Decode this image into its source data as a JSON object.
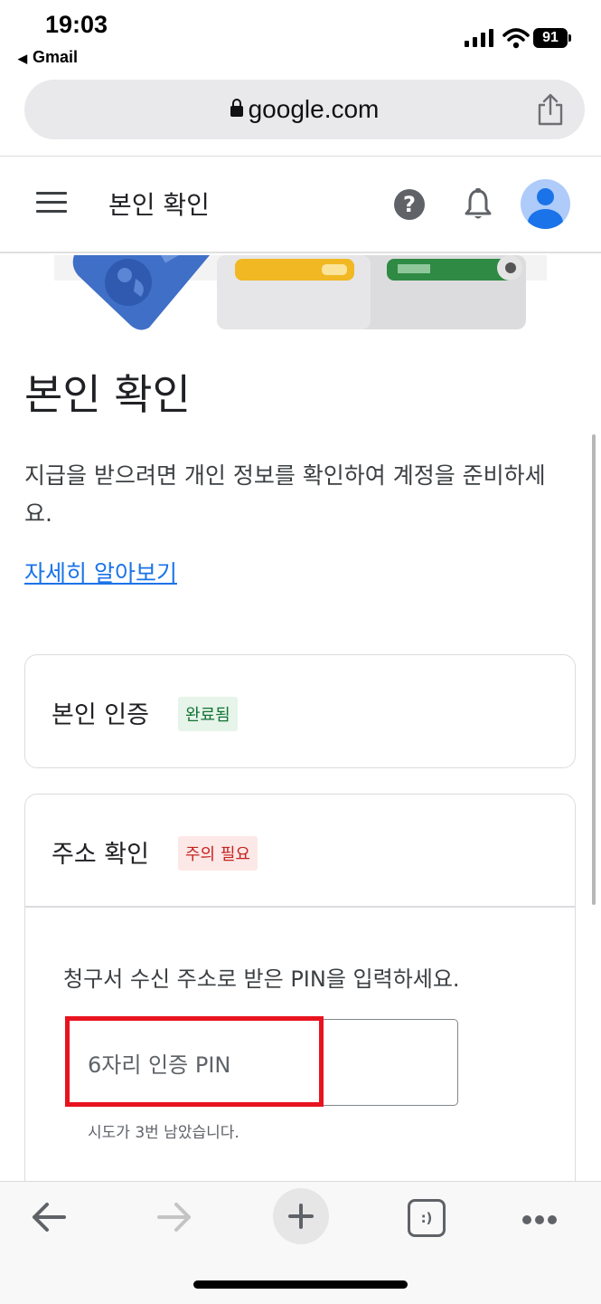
{
  "status_bar": {
    "time": "19:03",
    "back_app": "Gmail",
    "battery": "91"
  },
  "browser": {
    "url": "google.com"
  },
  "header": {
    "title": "본인 확인"
  },
  "page": {
    "title": "본인 확인",
    "description": "지급을 받으려면 개인 정보를 확인하여 계정을 준비하세요.",
    "learn_more": "자세히 알아보기"
  },
  "identity_card": {
    "title": "본인 인증",
    "badge": "완료됨"
  },
  "address_card": {
    "title": "주소 확인",
    "badge": "주의 필요",
    "instruction": "청구서 수신 주소로 받은 PIN을 입력하세요.",
    "pin_placeholder": "6자리 인증 PIN",
    "attempts": "시도가 3번 남았습니다."
  },
  "colors": {
    "link": "#1a73e8",
    "success": "#137333",
    "warning": "#c5221f",
    "highlight": "#e8131f"
  },
  "icons": [
    "lock-icon",
    "share-icon",
    "menu-icon",
    "help-icon",
    "bell-icon",
    "avatar",
    "back-arrow-icon",
    "forward-arrow-icon",
    "plus-icon",
    "tabs-icon",
    "more-icon"
  ]
}
